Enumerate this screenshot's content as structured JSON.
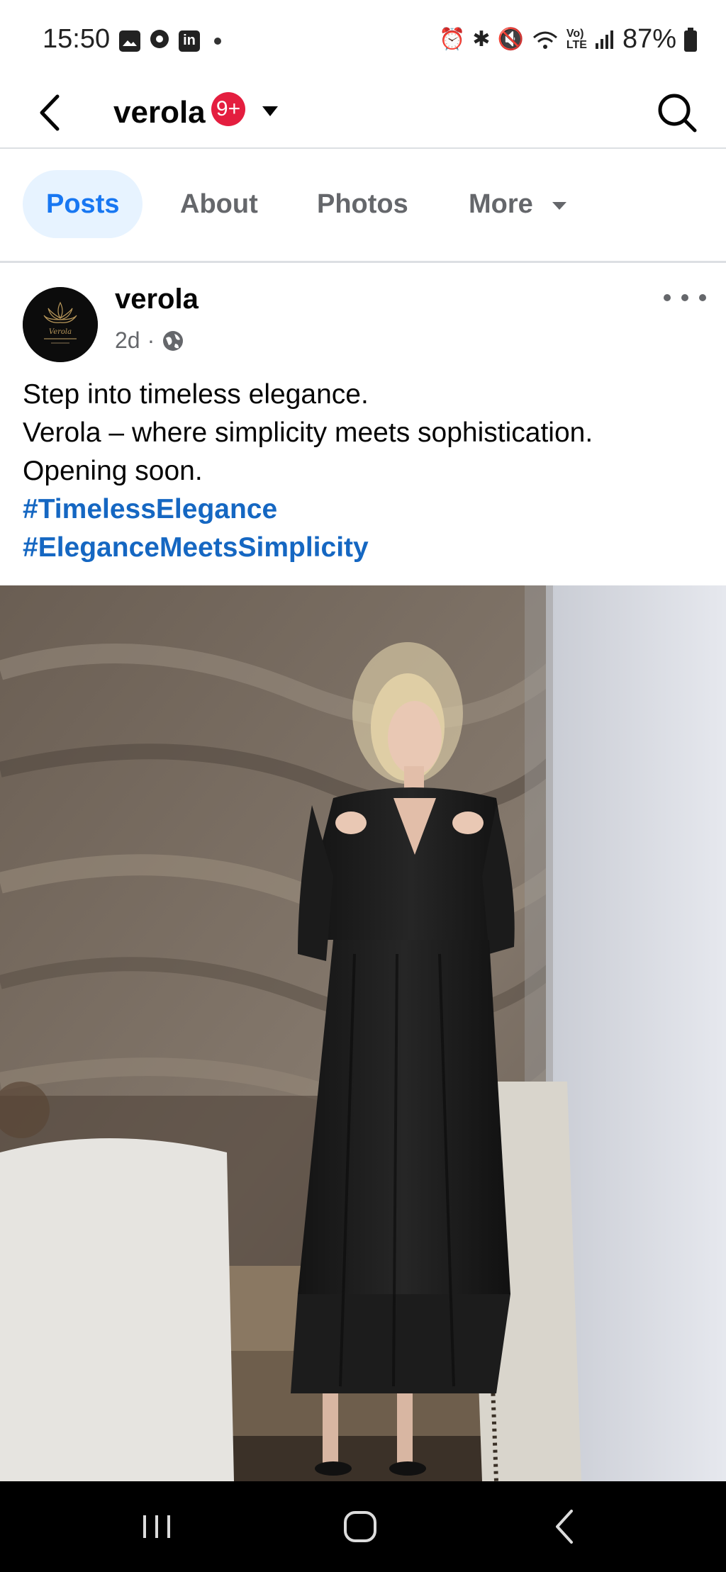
{
  "status_bar": {
    "time": "15:50",
    "battery": "87%",
    "left_icons": [
      "gallery-icon",
      "chrome-icon",
      "linkedin-icon",
      "dot-icon"
    ],
    "right_icons": [
      "alarm-icon",
      "bluetooth-icon",
      "mute-icon",
      "wifi-icon",
      "volte-icon",
      "signal-icon",
      "battery-icon"
    ]
  },
  "header": {
    "page_name": "verola",
    "badge": "9+"
  },
  "tabs": [
    {
      "label": "Posts",
      "active": true
    },
    {
      "label": "About",
      "active": false
    },
    {
      "label": "Photos",
      "active": false
    },
    {
      "label": "More",
      "active": false
    }
  ],
  "post": {
    "author": "verola",
    "time": "2d",
    "separator": "·",
    "lines": [
      "Step into timeless elegance.",
      "Verola – where simplicity meets sophistication.",
      "Opening soon."
    ],
    "hashtags": [
      "#TimelessElegance",
      "#EleganceMeetsSimplicity"
    ]
  },
  "colors": {
    "accent": "#1877f2",
    "hashtag": "#1567c2",
    "badge": "#e41e3f",
    "tab_active_bg": "#e7f3ff",
    "nav_bar": "#000000"
  }
}
